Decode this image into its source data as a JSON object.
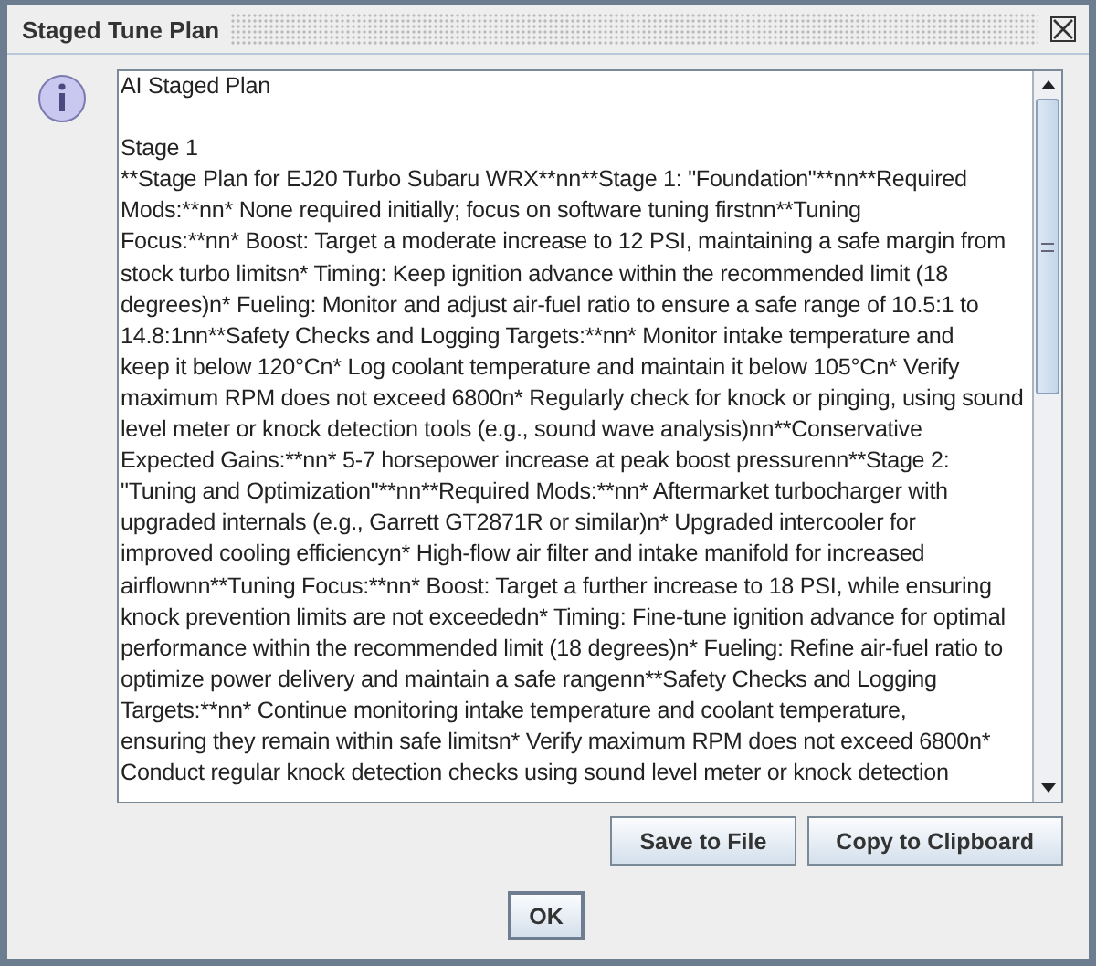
{
  "window": {
    "title": "Staged Tune Plan"
  },
  "heading": "AI Staged Plan",
  "text_lines": [
    "Stage 1",
    "**Stage Plan for EJ20 Turbo Subaru WRX**nn**Stage 1: \"Foundation\"**nn**Required",
    "Mods:**nn* None required initially; focus on software tuning firstnn**Tuning",
    "Focus:**nn* Boost: Target a moderate increase to 12 PSI, maintaining a safe margin from",
    "stock turbo limitsn* Timing: Keep ignition advance within the recommended limit (18",
    "degrees)n* Fueling: Monitor and adjust air-fuel ratio to ensure a safe range of 10.5:1 to",
    "14.8:1nn**Safety Checks and Logging Targets:**nn* Monitor intake temperature and",
    "keep it below 120°Cn* Log coolant temperature and maintain it below 105°Cn* Verify",
    "maximum RPM does not exceed 6800n* Regularly check for knock or pinging, using sound",
    "level meter or knock detection tools (e.g., sound wave analysis)nn**Conservative",
    "Expected Gains:**nn* 5-7 horsepower increase at peak boost pressurenn**Stage 2:",
    "\"Tuning and Optimization\"**nn**Required Mods:**nn* Aftermarket turbocharger with",
    "upgraded internals (e.g., Garrett GT2871R or similar)n* Upgraded intercooler for",
    "improved cooling efficiencyn* High-flow air filter and intake manifold for increased",
    "airflownn**Tuning Focus:**nn* Boost: Target a further increase to 18 PSI, while ensuring",
    "knock prevention limits are not exceededn* Timing: Fine-tune ignition advance for optimal",
    "performance within the recommended limit (18 degrees)n* Fueling: Refine air-fuel ratio to",
    "optimize power delivery and maintain a safe rangenn**Safety Checks and Logging",
    "Targets:**nn* Continue monitoring intake temperature and coolant temperature,",
    "ensuring they remain within safe limitsn* Verify maximum RPM does not exceed 6800n*",
    "Conduct regular knock detection checks using sound level meter or knock detection"
  ],
  "buttons": [
    "Save to File",
    "Copy to Clipboard"
  ],
  "ok_button": "OK"
}
